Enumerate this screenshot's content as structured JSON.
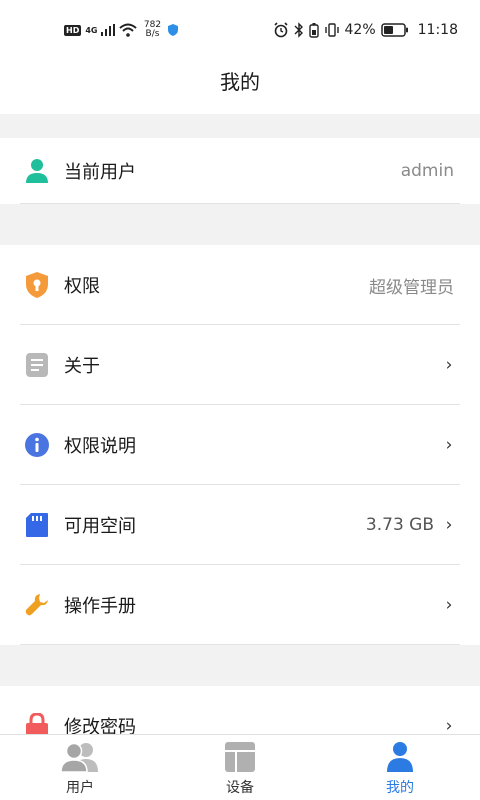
{
  "status": {
    "hd": "HD",
    "network": "4G",
    "speed_value": "782",
    "speed_unit": "B/s",
    "battery": "42%",
    "time": "11:18"
  },
  "header": {
    "title": "我的"
  },
  "user_card": {
    "label": "当前用户",
    "value": "admin"
  },
  "menu": {
    "permission": {
      "label": "权限",
      "value": "超级管理员"
    },
    "about": {
      "label": "关于"
    },
    "permission_desc": {
      "label": "权限说明"
    },
    "storage": {
      "label": "可用空间",
      "value": "3.73 GB"
    },
    "manual": {
      "label": "操作手册"
    }
  },
  "password": {
    "label": "修改密码"
  },
  "tabbar": {
    "items": [
      {
        "label": "用户"
      },
      {
        "label": "设备"
      },
      {
        "label": "我的"
      }
    ]
  },
  "colors": {
    "accent": "#2b7be3",
    "user_icon": "#1fbf9c",
    "shield_icon": "#f59a3a",
    "info_icon": "#4a74e0",
    "sd_icon": "#3568e6",
    "wrench_icon": "#f0a020",
    "lock_icon": "#f25b5b"
  }
}
